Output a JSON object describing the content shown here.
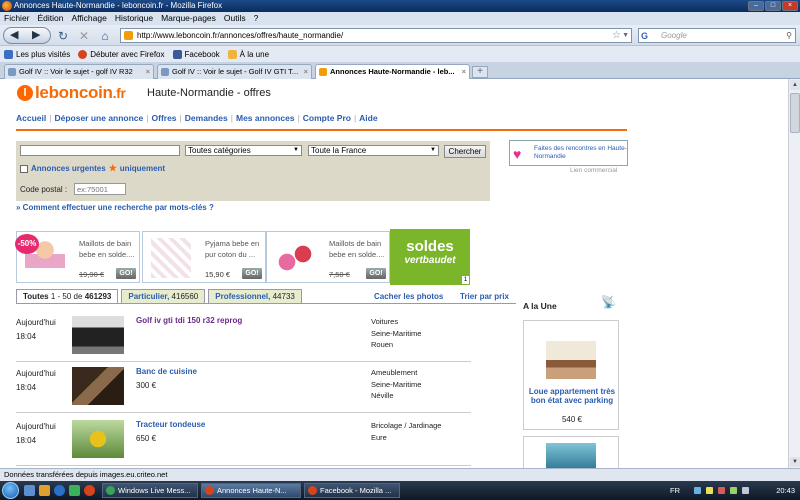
{
  "window": {
    "title": "Annonces Haute-Normandie - leboncoin.fr - Mozilla Firefox"
  },
  "menu": [
    "Fichier",
    "Édition",
    "Affichage",
    "Historique",
    "Marque-pages",
    "Outils",
    "?"
  ],
  "nav": {
    "url": "http://www.leboncoin.fr/annonces/offres/haute_normandie/",
    "search_placeholder": "Google",
    "search_engine": "G"
  },
  "bookmarks": [
    "Les plus visités",
    "Débuter avec Firefox",
    "Facebook",
    "À la une"
  ],
  "tabs": [
    {
      "label": "Golf IV :: Voir le sujet - golf IV R32"
    },
    {
      "label": "Golf IV :: Voir le sujet - Golf IV GTI T..."
    },
    {
      "label": "Annonces Haute-Normandie - leb..."
    }
  ],
  "site": {
    "logo_main": "leboncoin",
    "logo_tld": ".fr",
    "logo_icon": "l",
    "region_title": "Haute-Normandie - offres",
    "nav": [
      "Accueil",
      "Déposer une annonce",
      "Offres",
      "Demandes",
      "Mes annonces",
      "Compte Pro",
      "Aide"
    ],
    "separator": "|"
  },
  "search": {
    "category_value": "Toutes catégories",
    "location_value": "Toute la France",
    "button": "Chercher",
    "urgent_label": "Annonces urgentes",
    "urgent_suffix": "uniquement",
    "postal_label": "Code postal :",
    "postal_placeholder": "ex:75001",
    "keywords_link": "» Comment effectuer une recherche par mots-clés ?"
  },
  "promo": {
    "text": "Faites des rencontres en Haute-Normandie",
    "sponsored": "Lien commercial"
  },
  "products": [
    {
      "title": "Maillots de bain bebe en solde....",
      "price": "19,90 €",
      "go": "GO!",
      "badge": "-50%"
    },
    {
      "title": "Pyjama bebe en pur coton du ...",
      "price": "15,90 €",
      "go": "GO!"
    },
    {
      "title": "Maillots de bain bebe en solde....",
      "price": "7,50 €",
      "go": "GO!"
    }
  ],
  "ad_banner": {
    "line1": "soldes",
    "line2": "vertbaudet",
    "page": "1"
  },
  "list_tabs": {
    "all_label": "Toutes",
    "all_range": "1 - 50 de",
    "all_count": "461293",
    "private_label": "Particulier,",
    "private_count": "416560",
    "pro_label": "Professionnel,",
    "pro_count": "44733",
    "hide_photos": "Cacher les photos",
    "sort_price": "Trier par prix"
  },
  "listings": [
    {
      "day": "Aujourd'hui",
      "time": "18:04",
      "title": "Golf iv gti tdi 150 r32 reprog",
      "price": "",
      "category": "Voitures",
      "dept": "Seine-Maritime",
      "city": "Rouen"
    },
    {
      "day": "Aujourd'hui",
      "time": "18:04",
      "title": "Banc de cuisine",
      "price": "300 €",
      "category": "Ameublement",
      "dept": "Seine-Maritime",
      "city": "Néville"
    },
    {
      "day": "Aujourd'hui",
      "time": "18:04",
      "title": "Tracteur tondeuse",
      "price": "650 €",
      "category": "Bricolage / Jardinage",
      "dept": "Eure",
      "city": ""
    }
  ],
  "une": {
    "title": "A la Une",
    "item_title": "Loue appartement très bon état avec parking",
    "item_price": "540 €"
  },
  "status": "Données transférées depuis images.eu.criteo.net",
  "taskbar": {
    "tasks": [
      "Windows Live Mess...",
      "Annonces Haute-N...",
      "Facebook - Mozilla ..."
    ],
    "lang": "FR",
    "clock": "20:43"
  },
  "colors": {
    "brand": "#f56b0a",
    "link": "#2a5db0",
    "panel": "#ddd9c8"
  }
}
